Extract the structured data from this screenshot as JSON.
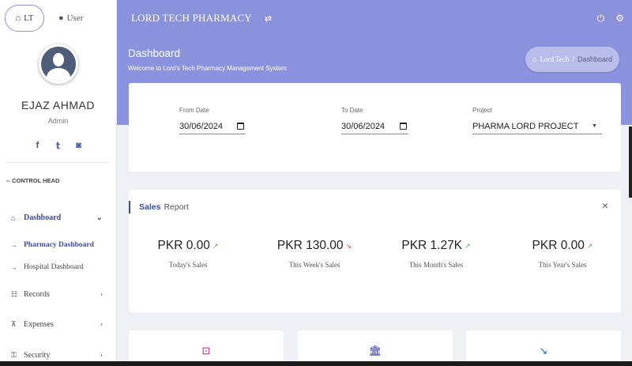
{
  "sidebar": {
    "tab_lt": "LT",
    "tab_user": "User",
    "profile_name": "EJAZ AHMAD",
    "profile_role": "Admin",
    "section_head": "-- CONTROL HEAD",
    "nav": {
      "dashboard": "Dashboard",
      "pharmacy_dashboard": "Pharmacy Dashboard",
      "hospital_dashboard": "Hospital Dashboard",
      "records": "Records",
      "expenses": "Expenses",
      "security": "Security"
    }
  },
  "topbar": {
    "brand": "LORD TECH PHARMACY"
  },
  "header": {
    "title": "Dashboard",
    "subtitle": "Welcome to Lord's Tech Pharmacy Management System",
    "breadcrumb_home": "Lord Tech",
    "breadcrumb_sep": "/",
    "breadcrumb_current": "Dashboard"
  },
  "filters": {
    "from_label": "From Date",
    "from_value": "30/06/2024",
    "to_label": "To Date",
    "to_value": "30/06/2024",
    "project_label": "Project",
    "project_value": "PHARMA LORD PROJECT"
  },
  "sales": {
    "title_bold": "Sales",
    "title_rest": "Report",
    "close": "×",
    "stats": [
      {
        "value": "PKR 0.00",
        "label": "Today's Sales",
        "trend": "up"
      },
      {
        "value": "PKR 130.00",
        "label": "This Week's Sales",
        "trend": "down"
      },
      {
        "value": "PKR 1.27K",
        "label": "This Month's Sales",
        "trend": "up"
      },
      {
        "value": "PKR 0.00",
        "label": "This Year's Sales",
        "trend": "up"
      }
    ]
  },
  "colors": {
    "accent": "#8b92dd",
    "primary_text": "#3a4aa8",
    "trend_up": "#3bb54a",
    "trend_down": "#e0443c"
  }
}
